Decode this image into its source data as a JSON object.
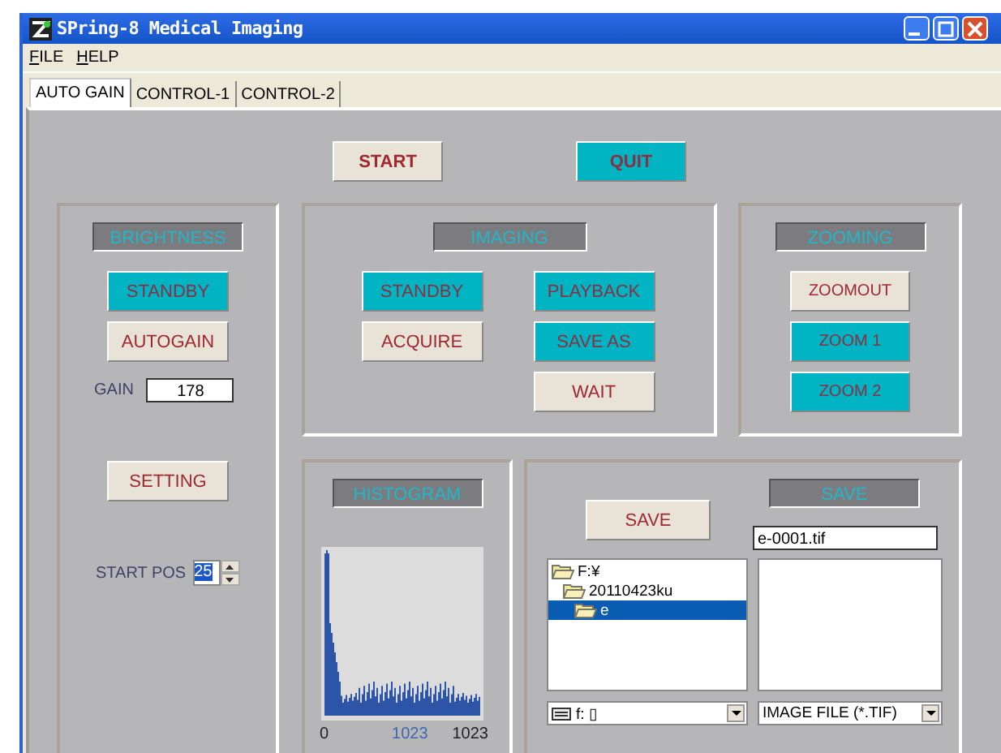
{
  "window": {
    "title": "SPring-8 Medical Imaging"
  },
  "menu": [
    "FILE",
    "HELP"
  ],
  "tabs": [
    {
      "label": "AUTO GAIN",
      "selected": true
    },
    {
      "label": "CONTROL-1",
      "selected": false
    },
    {
      "label": "CONTROL-2",
      "selected": false
    }
  ],
  "top_buttons": [
    {
      "label": "START",
      "active": false
    },
    {
      "label": "QUIT",
      "active": true
    }
  ],
  "brightness": {
    "title": "BRIGHTNESS",
    "buttons": [
      {
        "label": "STANDBY",
        "active": true
      },
      {
        "label": "AUTOGAIN",
        "active": false
      }
    ],
    "gain_label": "GAIN",
    "gain_value": "178",
    "setting_button": {
      "label": "SETTING",
      "active": false
    },
    "start_pos_label": "START POS",
    "start_pos_value": "25",
    "start_pos_text_selected": true
  },
  "imaging": {
    "title": "IMAGING",
    "left_buttons": [
      {
        "label": "STANDBY",
        "active": true
      },
      {
        "label": "ACQUIRE",
        "active": false
      }
    ],
    "right_buttons": [
      {
        "label": "PLAYBACK",
        "active": true
      },
      {
        "label": "SAVE AS",
        "active": true
      },
      {
        "label": "WAIT",
        "active": false
      }
    ]
  },
  "zooming": {
    "title": "ZOOMING",
    "buttons": [
      {
        "label": "ZOOMOUT",
        "active": false
      },
      {
        "label": "ZOOM 1",
        "active": true
      },
      {
        "label": "ZOOM 2",
        "active": true
      }
    ]
  },
  "histogram": {
    "title": "HISTOGRAM",
    "axis_labels": [
      {
        "text": "0",
        "kind": "plain"
      },
      {
        "text": "1023",
        "kind": "accent"
      },
      {
        "text": "1023",
        "kind": "plain"
      }
    ]
  },
  "save": {
    "button": {
      "label": "SAVE",
      "active": false
    },
    "title": "SAVE",
    "file_name": "e-0001.tif",
    "folders": [
      {
        "name": "F:¥",
        "selected": false,
        "children": [
          {
            "name": "20110423ku",
            "selected": false,
            "children": [
              {
                "name": "e",
                "selected": true
              }
            ]
          }
        ]
      }
    ],
    "drive": "f: ▯",
    "file_type": "IMAGE FILE (*.TIF)"
  }
}
